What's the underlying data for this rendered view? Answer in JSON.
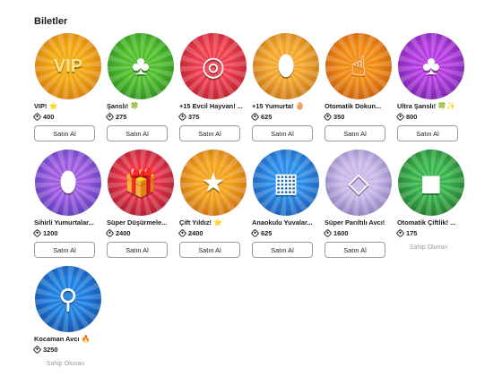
{
  "page": {
    "title": "Biletler"
  },
  "buy_label": "Satın Al",
  "owned_label": "Sahip Olunan",
  "items": [
    {
      "name": "VIP!",
      "badge": "⭐",
      "price": "400",
      "owned": false,
      "bg": "#f1a80f",
      "bg2": "#c8650a",
      "glyph": "VIP",
      "icon": "vip-crown-icon"
    },
    {
      "name": "Şanslı!",
      "badge": "🍀",
      "price": "275",
      "owned": false,
      "bg": "#4fbf2c",
      "bg2": "#1c7a12",
      "glyph": "♣",
      "icon": "clover-icon"
    },
    {
      "name": "+15 Evcil Hayvan! ...",
      "badge": "",
      "price": "375",
      "owned": false,
      "bg": "#ef3e4e",
      "bg2": "#a3131f",
      "glyph": "◎",
      "icon": "pet-collar-icon"
    },
    {
      "name": "+15 Yumurta!",
      "badge": "🥚",
      "price": "625",
      "owned": false,
      "bg": "#f4a62a",
      "bg2": "#b05e0b",
      "glyph": "⬮",
      "icon": "egg-icon"
    },
    {
      "name": "Otomatik Dokun...",
      "badge": "",
      "price": "350",
      "owned": false,
      "bg": "#f28b12",
      "bg2": "#b24706",
      "glyph": "☝",
      "icon": "tap-hand-icon"
    },
    {
      "name": "Ultra Şanslı!",
      "badge": "🍀✨",
      "price": "800",
      "owned": false,
      "bg": "#b43be0",
      "bg2": "#5b1591",
      "glyph": "♣",
      "icon": "ultra-clover-icon"
    },
    {
      "name": "Sihirli Yumurtalar...",
      "badge": "",
      "price": "1200",
      "owned": false,
      "bg": "#9d5be0",
      "bg2": "#3f2aa8",
      "glyph": "⬮",
      "icon": "magic-egg-icon"
    },
    {
      "name": "Süper Düşürmele...",
      "badge": "",
      "price": "2400",
      "owned": false,
      "bg": "#e8354a",
      "bg2": "#8e1124",
      "glyph": "🎁",
      "icon": "gift-box-icon"
    },
    {
      "name": "Çift Yıldız!",
      "badge": "⭐",
      "price": "2400",
      "owned": false,
      "bg": "#f3a21a",
      "bg2": "#b8590a",
      "glyph": "★",
      "icon": "double-star-icon"
    },
    {
      "name": "Anaokulu Yuvalar...",
      "badge": "",
      "price": "625",
      "owned": false,
      "bg": "#2a8de8",
      "bg2": "#14459e",
      "glyph": "▦",
      "icon": "toy-blocks-icon"
    },
    {
      "name": "Süper Parıltılı Avcı!",
      "badge": "",
      "price": "1600",
      "owned": false,
      "bg": "#c9b8e8",
      "bg2": "#6d5fa8",
      "glyph": "◇",
      "icon": "sparkle-cube-icon"
    },
    {
      "name": "Otomatik Çiftlik! ...",
      "badge": "",
      "price": "175",
      "owned": true,
      "bg": "#37b34a",
      "bg2": "#14601e",
      "glyph": "◼",
      "icon": "farm-cat-icon"
    },
    {
      "name": "Kocaman Avcı",
      "badge": "🔥",
      "price": "3250",
      "owned": true,
      "bg": "#1e7fe0",
      "bg2": "#0c3a8c",
      "glyph": "⚲",
      "icon": "magnifier-icon"
    }
  ]
}
